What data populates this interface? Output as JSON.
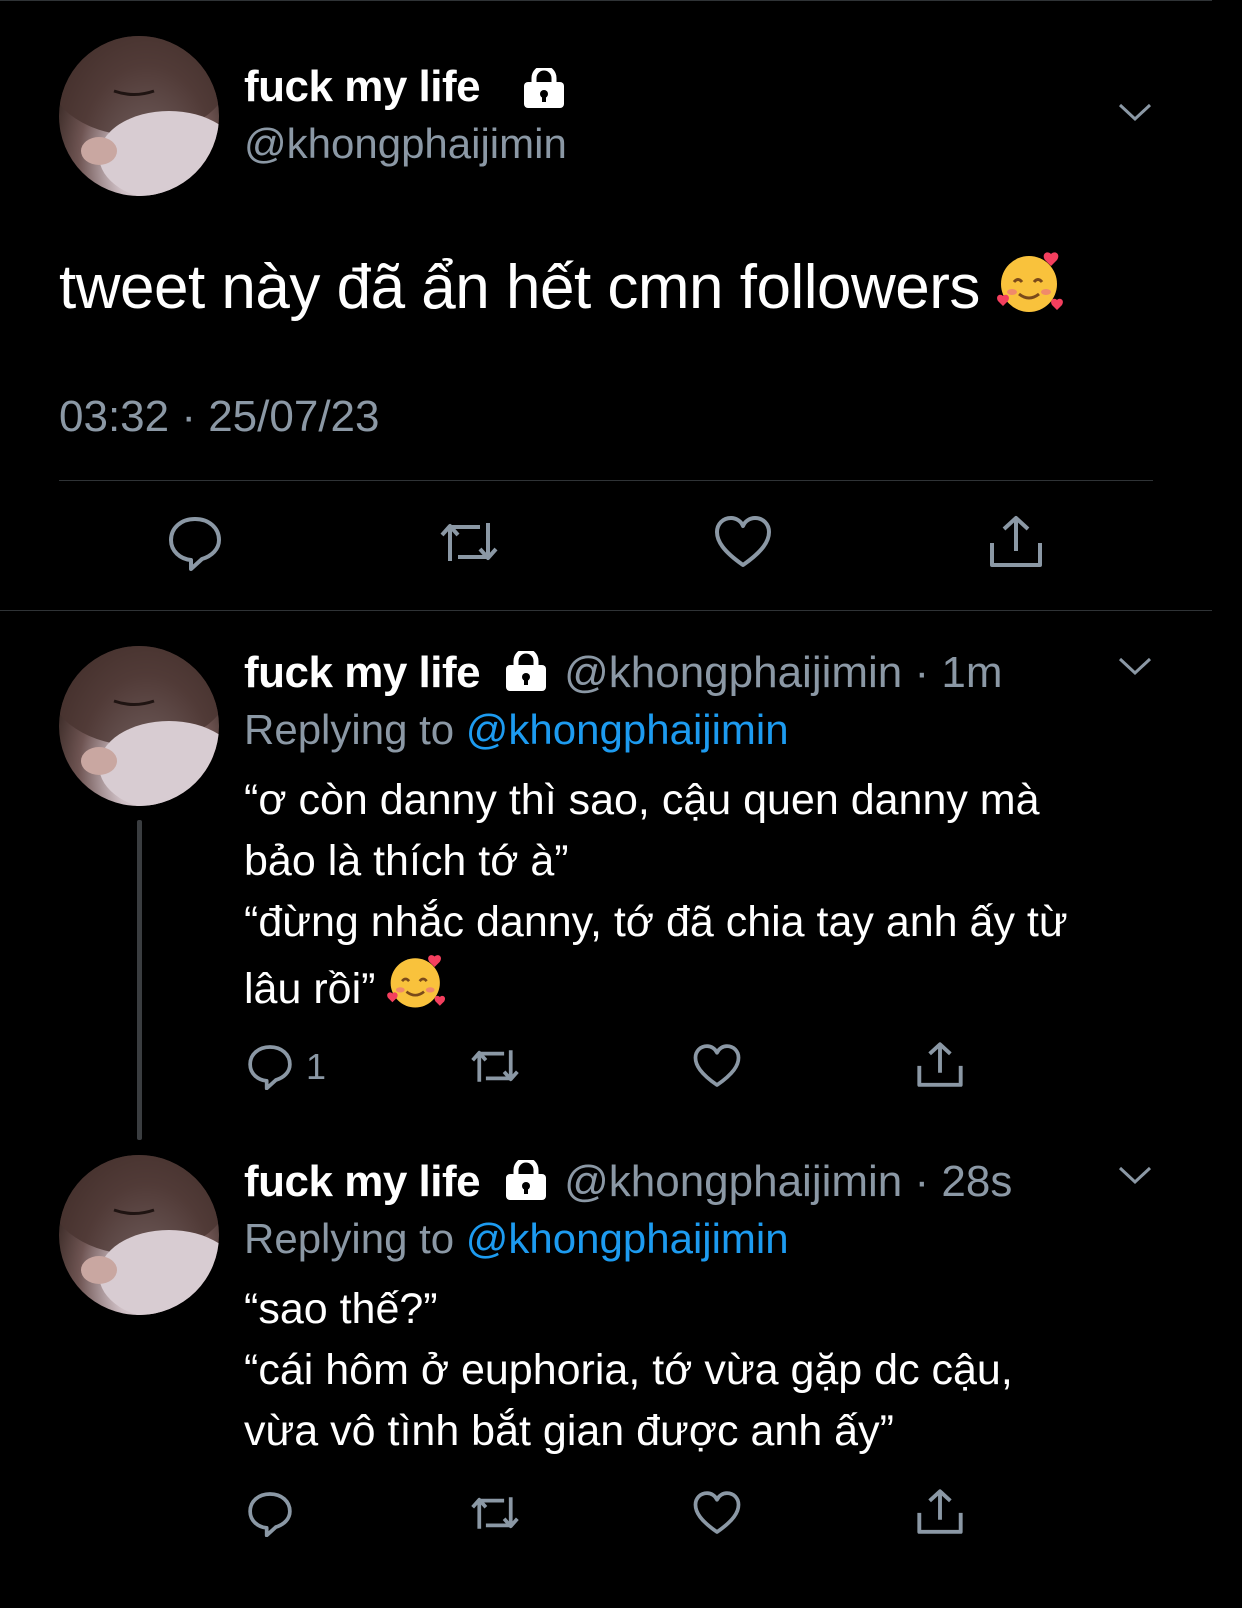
{
  "main_tweet": {
    "display_name": "fuck my life",
    "handle": "@khongphaijimin",
    "text": "tweet này đã ẩn hết cmn followers",
    "emoji": "smiling-face-with-hearts",
    "timestamp": "03:32 · 25/07/23",
    "actions": [
      "reply-icon",
      "retweet-icon",
      "like-icon",
      "share-icon"
    ]
  },
  "replies": [
    {
      "display_name": "fuck my life",
      "handle": "@khongphaijimin",
      "time_sep": " · ",
      "time": "1m",
      "replying_label": "Replying to ",
      "replying_handle": "@khongphaijimin",
      "text": "“ơ còn danny thì sao, cậu quen danny mà\nbảo là thích tớ à”\n“đừng nhắc danny, tớ đã chia tay anh ấy từ\nlâu rồi” ",
      "emoji": "smiling-face-with-hearts",
      "reply_count": "1"
    },
    {
      "display_name": "fuck my life",
      "handle": "@khongphaijimin",
      "time_sep": " · ",
      "time": "28s",
      "replying_label": "Replying to ",
      "replying_handle": "@khongphaijimin",
      "text": "“sao thế?”\n“cái hôm ở euphoria, tớ vừa gặp dc cậu,\nvừa vô tình bắt gian được anh ấy”",
      "reply_count": ""
    }
  ],
  "colors": {
    "background": "#000000",
    "text": "#ffffff",
    "muted": "#8b98a5",
    "link": "#1d9bf0",
    "divider": "#2f3336"
  }
}
